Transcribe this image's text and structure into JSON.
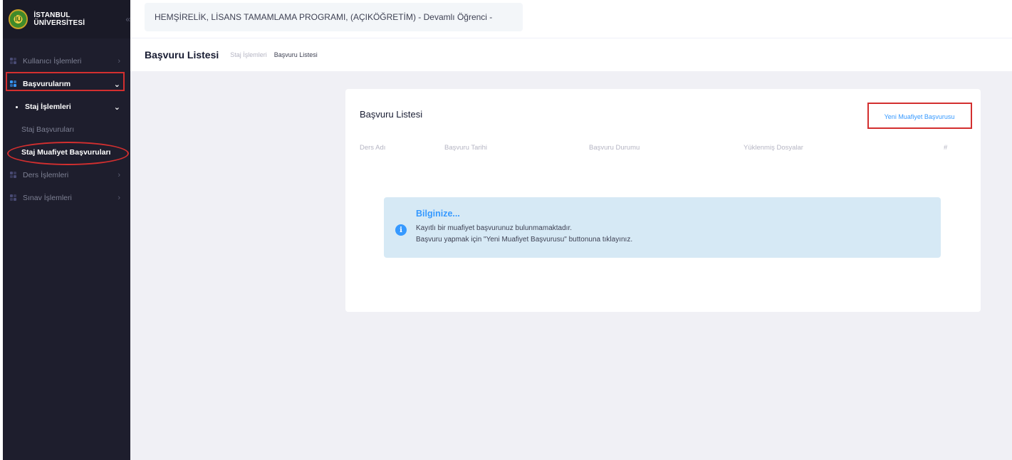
{
  "sidebar": {
    "brand": {
      "name": "İSTANBUL ÜNİVERSİTESİ",
      "logo_text": "İÜ"
    },
    "items": [
      {
        "label": "Kullanıcı İşlemleri",
        "chevron": "›"
      },
      {
        "label": "Başvurularım",
        "chevron": "⌄"
      },
      {
        "label": "Staj İşlemleri",
        "chevron": "⌄"
      },
      {
        "label": "Staj Başvuruları"
      },
      {
        "label": "Staj Muafiyet Başvuruları"
      },
      {
        "label": "Ders İşlemleri",
        "chevron": "›"
      },
      {
        "label": "Sınav İşlemleri",
        "chevron": "›"
      }
    ],
    "collapse_glyph": "«"
  },
  "header": {
    "program": "HEMŞİRELİK, LİSANS TAMAMLAMA PROGRAMI, (AÇIKÖĞRETİM) - Devamlı Öğrenci -"
  },
  "subheader": {
    "title": "Başvuru Listesi",
    "breadcrumbs": [
      "Staj İşlemleri",
      "Başvuru Listesi"
    ]
  },
  "card": {
    "title": "Başvuru Listesi",
    "new_button": "Yeni Muafiyet Başvurusu",
    "columns": [
      "Ders Adı",
      "Başvuru Tarihi",
      "Başvuru Durumu",
      "Yüklenmiş Dosyalar",
      "#"
    ],
    "alert": {
      "title": "Bilginize...",
      "line1": "Kayıtlı bir muafiyet başvurunuz bulunmamaktadır.",
      "line2": "Başvuru yapmak için \"Yeni Muafiyet Başvurusu\" buttonuna tıklayınız.",
      "icon_glyph": "i"
    }
  },
  "colors": {
    "sidebar_bg": "#1e1e2d",
    "accent": "#3699ff",
    "highlight": "#d32f2f",
    "alert_bg": "#d6e9f5"
  }
}
